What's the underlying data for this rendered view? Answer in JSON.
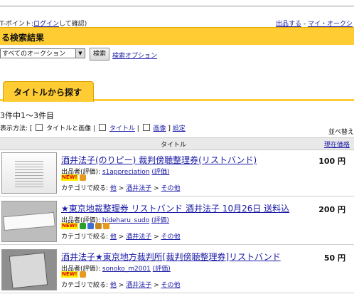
{
  "topbar": {
    "left_prefix": "T-ポイント:",
    "login_link": "ログイン",
    "left_suffix": "して確認)",
    "right_link1": "出品する",
    "right_sep": " - ",
    "right_link2": "マイ・オークシ"
  },
  "page_title": "る検索結果",
  "search": {
    "scope_value": "すべてのオークション",
    "button_label": "検索",
    "options_link": "検索オプション"
  },
  "tab_label": "タイトルから探す",
  "results_count": "3件中1～3件目",
  "display_mode": {
    "label": "表示方法: [",
    "option1": "タイトルと画像",
    "sep1": " | ",
    "option2": "タイトル",
    "sep2": " | ",
    "option3": "画像",
    "close": " ]",
    "settings": "設定"
  },
  "sort_label": "並べ替え",
  "columns": {
    "title": "タイトル",
    "price": "現在価格"
  },
  "items": [
    {
      "title": "酒井法子(のりピー) 裁判傍聴整理券(リストバンド)",
      "seller_prefix": "出品者(評価): ",
      "seller": "s1appreciation",
      "rating": "(評価)",
      "new_badge": "NEW!",
      "cat_prefix": "カテゴリで絞る: ",
      "cat1": "他",
      "cat2": "酒井法子",
      "cat3": "その他",
      "price": "100 円"
    },
    {
      "title": "★東京地裁整理券 リストバンド 酒井法子 10月26日 送料込",
      "seller_prefix": "出品者(評価): ",
      "seller": "hideharu_sudo",
      "rating": "(評価)",
      "new_badge": "NEW!",
      "cat_prefix": "カテゴリで絞る: ",
      "cat1": "他",
      "cat2": "酒井法子",
      "cat3": "その他",
      "price": "200 円"
    },
    {
      "title": "酒井法子★東京地方裁判所[裁判傍聴整理券]リストバンド",
      "seller_prefix": "出品者(評価): ",
      "seller": "sonoko_m2001",
      "rating": "(評価)",
      "new_badge": "NEW!",
      "cat_prefix": "カテゴリで絞る: ",
      "cat1": "他",
      "cat2": "酒井法子",
      "cat3": "その他",
      "price": "50 円"
    }
  ],
  "colors": {
    "accent": "#ffcc33",
    "link": "#1a1aa6"
  }
}
